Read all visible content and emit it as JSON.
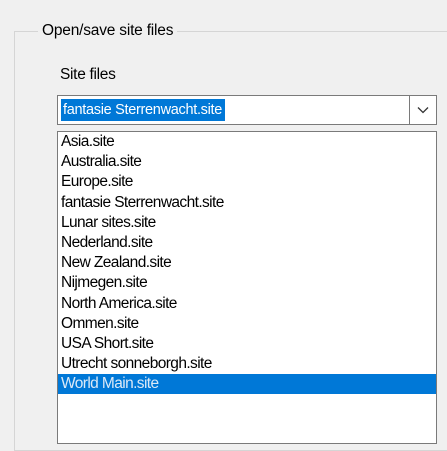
{
  "group": {
    "title": "Open/save site files"
  },
  "site_files": {
    "label": "Site files",
    "selected_value": "fantasie Sterrenwacht.site",
    "options": [
      "Asia.site",
      "Australia.site",
      "Europe.site",
      "fantasie Sterrenwacht.site",
      "Lunar sites.site",
      "Nederland.site",
      "New Zealand.site",
      "Nijmegen.site",
      "North America.site",
      "Ommen.site",
      "USA Short.site",
      "Utrecht sonneborgh.site",
      "World Main.site"
    ],
    "highlighted_option": "World Main.site"
  },
  "icons": {
    "dropdown_arrow": "chevron-down-icon"
  },
  "colors": {
    "selection": "#0078d7",
    "border": "#7a7a7a",
    "background": "#f0f0f0"
  }
}
